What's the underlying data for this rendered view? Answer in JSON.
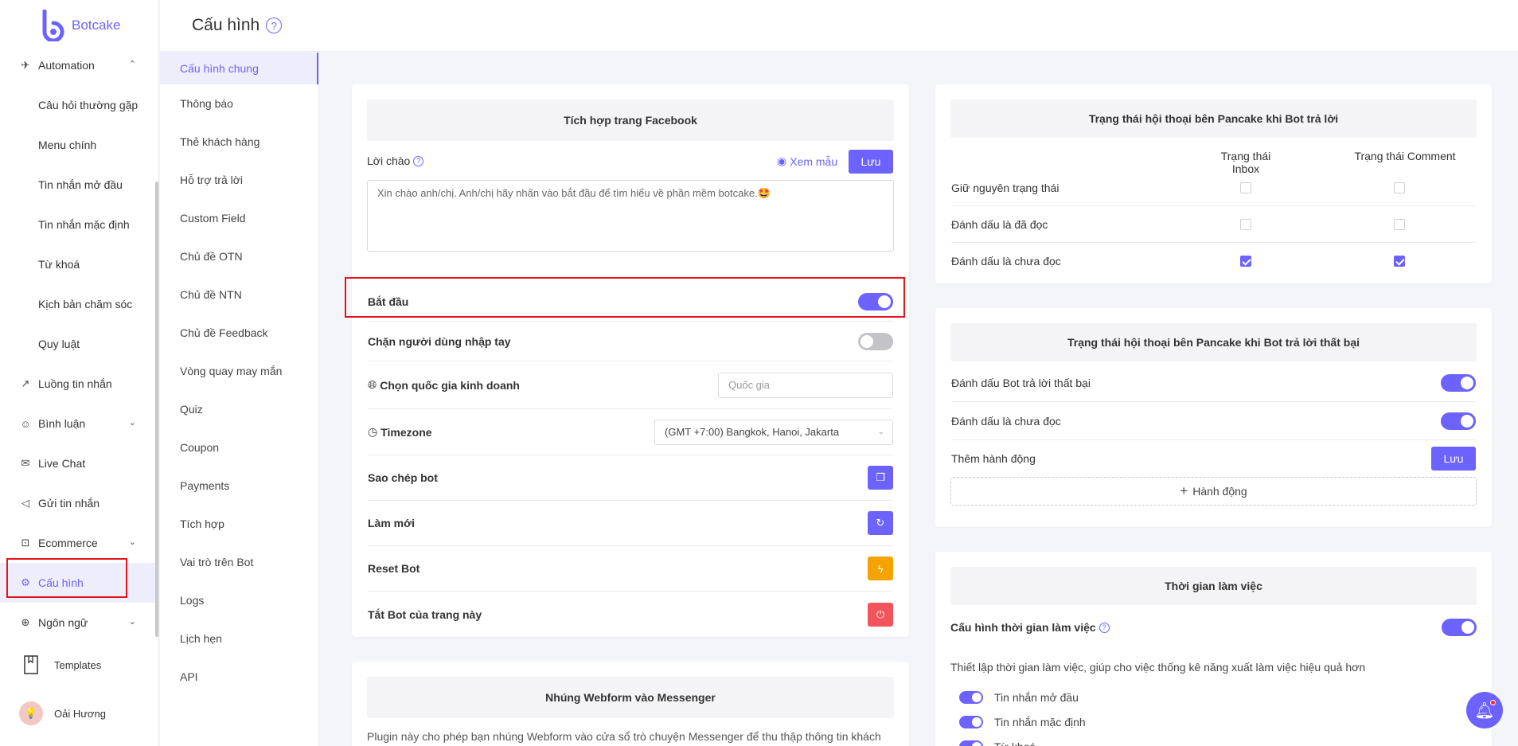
{
  "app": {
    "name": "Botcake"
  },
  "sidebar": {
    "items": [
      {
        "label": "Automation",
        "icon": "rocket-icon",
        "chevron": "^"
      },
      {
        "label": "Câu hỏi thường gặp",
        "sub": true
      },
      {
        "label": "Menu chính",
        "sub": true
      },
      {
        "label": "Tin nhắn mở đầu",
        "sub": true
      },
      {
        "label": "Tin nhắn mặc định",
        "sub": true
      },
      {
        "label": "Từ khoá",
        "sub": true
      },
      {
        "label": "Kịch bản chăm sóc",
        "sub": true
      },
      {
        "label": "Quy luật",
        "sub": true
      },
      {
        "label": "Luồng tin nhắn",
        "icon": "flow-icon"
      },
      {
        "label": "Bình luận",
        "icon": "comment-icon",
        "chevron": "v"
      },
      {
        "label": "Live Chat",
        "icon": "mail-icon"
      },
      {
        "label": "Gửi tin nhắn",
        "icon": "megaphone-icon"
      },
      {
        "label": "Ecommerce",
        "icon": "cart-icon",
        "chevron": "v"
      },
      {
        "label": "Cấu hình",
        "icon": "gear-icon",
        "active": true
      },
      {
        "label": "Ngôn ngữ",
        "icon": "globe-icon",
        "chevron": "v"
      }
    ],
    "templates_label": "Templates",
    "user_name": "Oải Hương"
  },
  "header": {
    "title": "Cấu hình"
  },
  "submenu": [
    "Cấu hình chung",
    "Thông báo",
    "Thẻ khách hàng",
    "Hỗ trợ trả lời",
    "Custom Field",
    "Chủ đề OTN",
    "Chủ đề NTN",
    "Chủ đề Feedback",
    "Vòng quay may mắn",
    "Quiz",
    "Coupon",
    "Payments",
    "Tích hợp",
    "Vai trò trên Bot",
    "Logs",
    "Lịch hẹn",
    "API"
  ],
  "facebook_card": {
    "title": "Tích hợp trang Facebook",
    "greeting_label": "Lời chào",
    "preview_label": "Xem mẫu",
    "save_label": "Lưu",
    "greeting_text": "Xin chào anh/chị. Anh/chị hãy nhấn vào bắt đầu để tìm hiểu về phần mềm botcake.🤩",
    "start_label": "Bắt đầu",
    "block_label": "Chặn người dùng nhập tay",
    "country_label": "Chọn quốc gia kinh doanh",
    "country_placeholder": "Quốc gia",
    "timezone_label": "Timezone",
    "timezone_value": "(GMT +7:00) Bangkok, Hanoi, Jakarta",
    "copy_label": "Sao chép bot",
    "refresh_label": "Làm mới",
    "reset_label": "Reset Bot",
    "off_label": "Tắt Bot của trang này"
  },
  "webform_card": {
    "title": "Nhúng Webform vào Messenger",
    "desc": "Plugin này cho phép bạn nhúng Webform vào cửa sổ trò chuyện Messenger để thu thập thông tin khách"
  },
  "status_card": {
    "title": "Trạng thái hội thoại bên Pancake khi Bot trả lời",
    "col_inbox": "Trạng thái Inbox",
    "col_comment": "Trạng thái Comment",
    "rows": [
      {
        "label": "Giữ nguyên trạng thái",
        "inbox": false,
        "comment": false
      },
      {
        "label": "Đánh dấu là đã đọc",
        "inbox": false,
        "comment": false
      },
      {
        "label": "Đánh dấu là chưa đọc",
        "inbox": true,
        "comment": true
      }
    ]
  },
  "fail_card": {
    "title": "Trạng thái hội thoại bên Pancake khi Bot trả lời thất bại",
    "mark_fail_label": "Đánh dấu Bot trả lời thất bại",
    "mark_unread_label": "Đánh dấu là chưa đọc",
    "add_action_label": "Thêm hành động",
    "save_label": "Lưu",
    "action_button_label": "Hành động"
  },
  "worktime_card": {
    "title": "Thời gian làm việc",
    "config_label": "Cấu hình thời gian làm việc",
    "desc": "Thiết lập thời gian làm việc, giúp cho việc thống kê năng xuất làm việc hiệu quả hơn",
    "options": [
      "Tin nhắn mở đầu",
      "Tin nhắn mặc định",
      "Từ khoá"
    ]
  },
  "colors": {
    "accent": "#6c63ff",
    "warning": "#f5a300",
    "danger": "#f2545b",
    "highlight": "#e3141b"
  }
}
